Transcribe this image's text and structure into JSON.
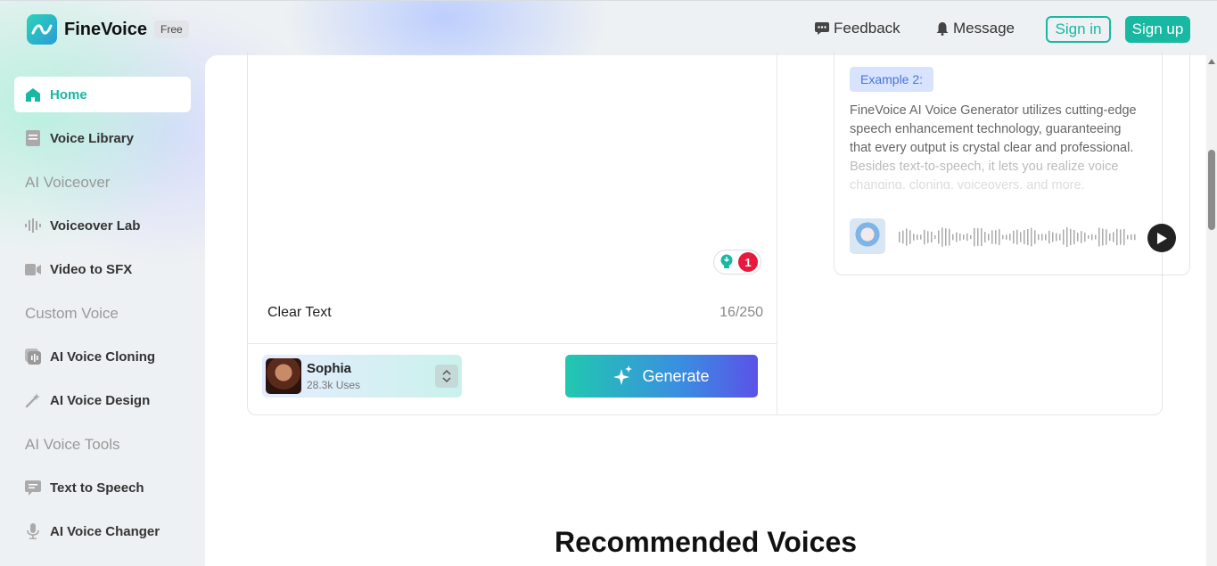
{
  "app": {
    "name": "FineVoice",
    "badge": "Free"
  },
  "topnav": {
    "feedback": "Feedback",
    "message": "Message",
    "signin": "Sign in",
    "signup": "Sign up"
  },
  "sidebar": {
    "home": "Home",
    "voice_library": "Voice Library",
    "section_ai_voiceover": "AI Voiceover",
    "voiceover_lab": "Voiceover Lab",
    "video_to_sfx": "Video to SFX",
    "section_custom_voice": "Custom Voice",
    "ai_voice_cloning": "AI Voice Cloning",
    "ai_voice_design": "AI Voice Design",
    "section_ai_voice_tools": "AI Voice Tools",
    "text_to_speech": "Text to Speech",
    "ai_voice_changer": "AI Voice Changer"
  },
  "editor": {
    "tip_count": "1",
    "clear_text": "Clear Text",
    "char_counter": "16/250",
    "voice_name": "Sophia",
    "voice_uses": "28.3k Uses",
    "generate": "Generate"
  },
  "example": {
    "tag": "Example 2:",
    "line1": "FineVoice AI Voice Generator utilizes cutting-edge",
    "line2": "speech enhancement technology, guaranteeing",
    "line3": "that every output is crystal clear and professional.",
    "line4": "Besides text-to-speech, it lets you realize voice",
    "line5": "changing, cloning, voiceovers, and more."
  },
  "recommended_title": "Recommended Voices",
  "colors": {
    "accent": "#18b8a3",
    "alert": "#e8193c"
  }
}
